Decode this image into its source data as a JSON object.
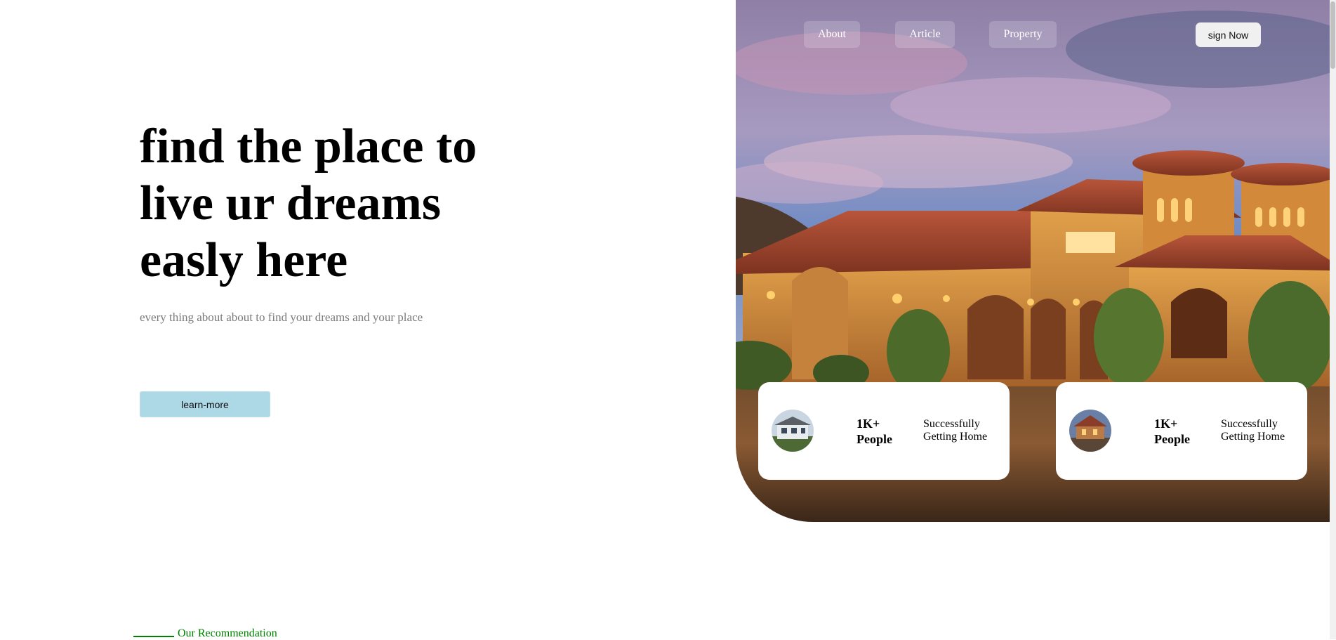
{
  "hero": {
    "title_lines": [
      "find the place to",
      "live ur dreams",
      "easly here"
    ],
    "subtitle": "every thing about about to find your dreams and your place",
    "cta_label": "learn-more"
  },
  "nav": {
    "items": [
      {
        "label": "About"
      },
      {
        "label": "Article"
      },
      {
        "label": "Property"
      }
    ],
    "sign_label": "sign Now"
  },
  "stats": [
    {
      "count": "1K+ People",
      "description": "Successfully Getting Home",
      "avatar_icon": "house-photo"
    },
    {
      "count": "1K+ People",
      "description": "Successfully Getting Home",
      "avatar_icon": "house-photo"
    }
  ],
  "recommendation": {
    "label": "Our Recommendation",
    "accent": "#008000"
  },
  "colors": {
    "cta_background": "#add8e6",
    "card_background": "#ffffff"
  }
}
